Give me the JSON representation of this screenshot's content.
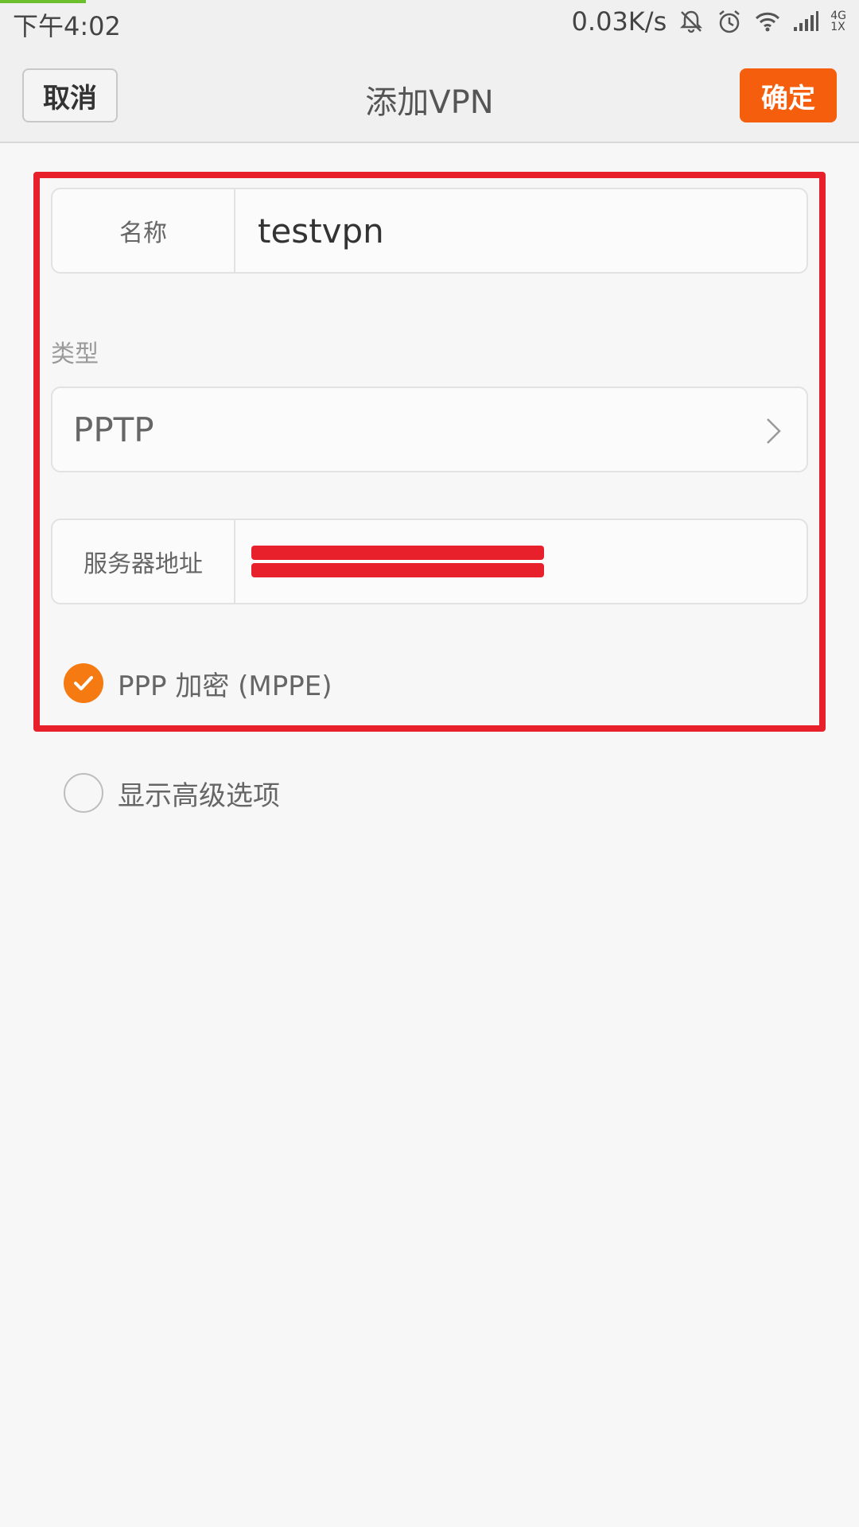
{
  "status_bar": {
    "time": "下午4:02",
    "net_speed": "0.03K/s",
    "network_top": "4G",
    "network_bottom": "1X"
  },
  "header": {
    "cancel_label": "取消",
    "title": "添加VPN",
    "ok_label": "确定"
  },
  "form": {
    "name_label": "名称",
    "name_value": "testvpn",
    "type_section_label": "类型",
    "type_value": "PPTP",
    "server_label": "服务器地址",
    "server_value": "",
    "ppp_label": "PPP 加密 (MPPE)",
    "ppp_checked": true,
    "advanced_label": "显示高级选项",
    "advanced_checked": false
  },
  "colors": {
    "accent": "#f55e0d",
    "annotation": "#e8202c"
  }
}
